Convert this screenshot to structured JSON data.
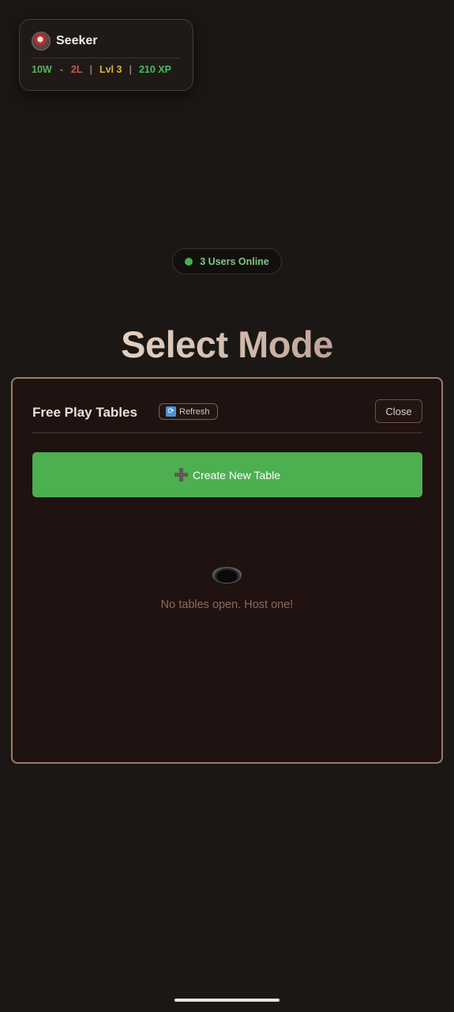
{
  "profile": {
    "name": "Seeker",
    "wins": "10W",
    "dash": "-",
    "losses": "2L",
    "pipe": "|",
    "level": "Lvl 3",
    "xp": "210 XP"
  },
  "online": {
    "text": "3 Users Online",
    "dot_color": "#4caf50"
  },
  "title": "Select Mode",
  "panel": {
    "title": "Free Play Tables",
    "refresh_icon": "refresh-icon",
    "refresh_label": "Refresh",
    "close_label": "Close",
    "create_icon": "plus-icon",
    "create_label": "Create New Table",
    "empty_icon": "hole-icon",
    "empty_text": "No tables open. Host one!"
  },
  "colors": {
    "accent_green": "#4caf50",
    "panel_border": "#9a7b6c",
    "background": "#1b1714"
  }
}
